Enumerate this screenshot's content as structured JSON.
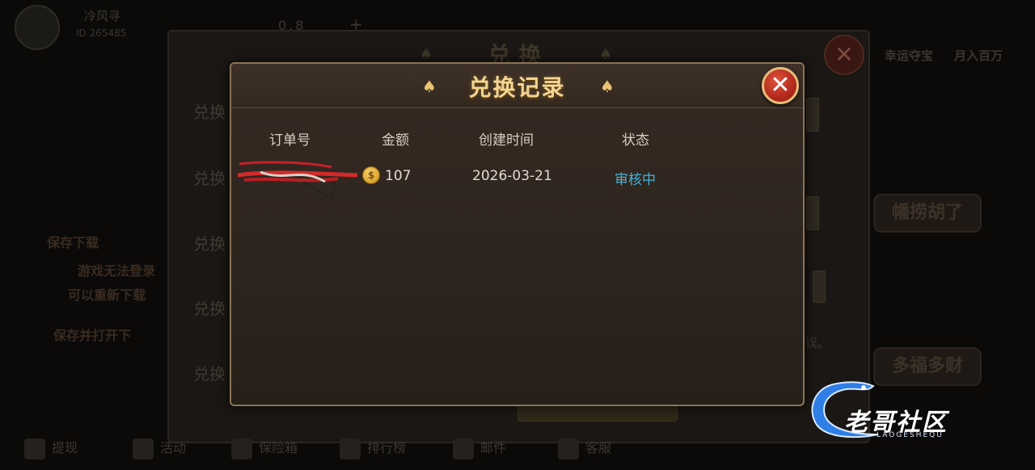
{
  "background": {
    "player_name": "冷风寻",
    "player_id": "ID 265485",
    "balance": "0.8",
    "right_top_labels": [
      "幸运夺宝",
      "月入百万"
    ],
    "exchange_panel_title": "兑换",
    "exchange_tabs": [
      "兑换",
      "兑换",
      "兑换",
      "兑换",
      "兑换"
    ],
    "side_text": "误。",
    "promo_lines": [
      "保存下载",
      "游戏无法登录",
      "可以重新下载",
      "保存并打开下"
    ],
    "game_tiles": [
      "幡捞胡了",
      "多福多财"
    ],
    "bottom_nav": [
      "提现",
      "活动",
      "保险箱",
      "排行榜",
      "邮件",
      "客服"
    ]
  },
  "dialog": {
    "title": "兑换记录",
    "close_label": "✕",
    "columns": [
      "订单号",
      "金额",
      "创建时间",
      "状态"
    ],
    "records": [
      {
        "order_no": "",
        "amount": "107",
        "created": "2026-03-21",
        "status": "审核中"
      }
    ]
  },
  "watermark": {
    "text": "老哥社区",
    "sub": "LAOGESHEQU"
  },
  "colors": {
    "accent_gold": "#f3d592",
    "status_blue": "#46b2d9",
    "close_red": "#b22a1d"
  }
}
